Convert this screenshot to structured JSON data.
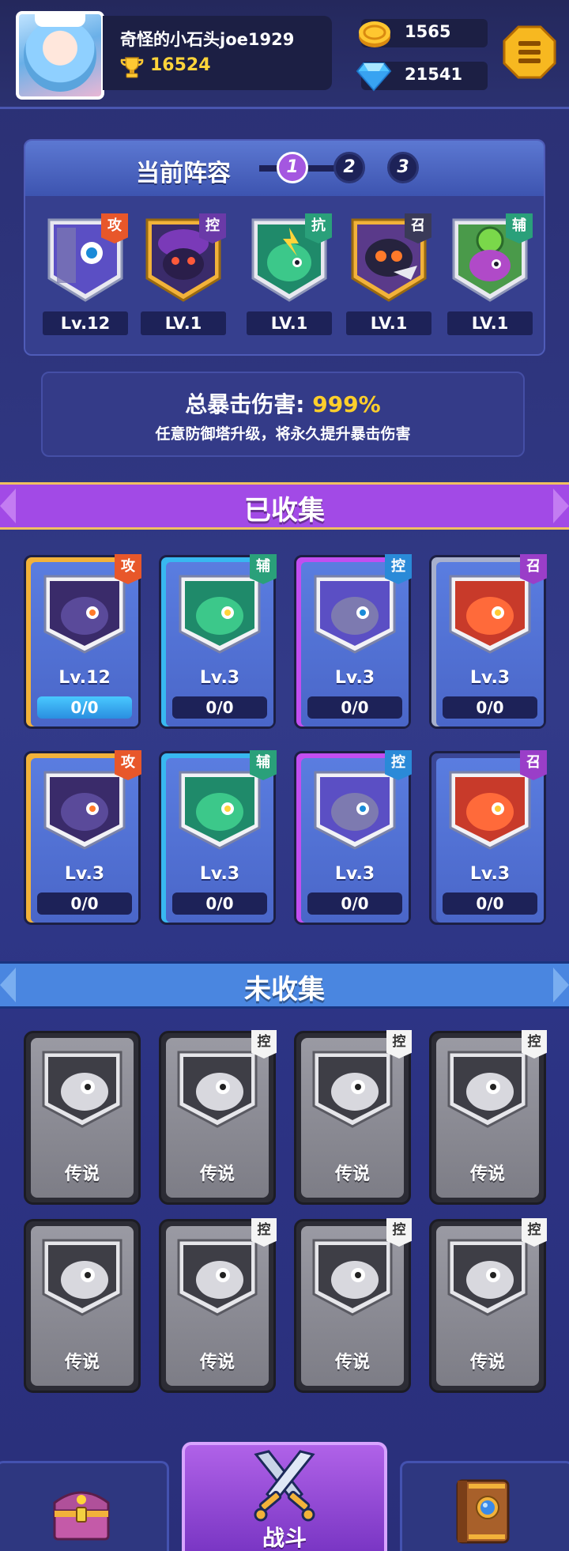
{
  "player": {
    "name": "奇怪的小石头joe1929",
    "trophies": "16524"
  },
  "resources": {
    "coins": "1565",
    "diamonds": "21541"
  },
  "lineup": {
    "title": "当前阵容",
    "slots": [
      "1",
      "2",
      "3"
    ],
    "active_slot": "1",
    "heroes": [
      {
        "tag": "攻",
        "level": "Lv.12",
        "color": "#5b4fc4"
      },
      {
        "tag": "控",
        "level": "LV.1",
        "color": "#6a3aa8"
      },
      {
        "tag": "抗",
        "level": "LV.1",
        "color": "#2aa86a"
      },
      {
        "tag": "召",
        "level": "LV.1",
        "color": "#3a3a58"
      },
      {
        "tag": "辅",
        "level": "LV.1",
        "color": "#3aa86a"
      }
    ]
  },
  "crit": {
    "title": "总暴击伤害:",
    "value": "999%",
    "subtitle": "任意防御塔升级，将永久提升暴击伤害"
  },
  "collected": {
    "title": "已收集",
    "cards": [
      {
        "tag": "攻",
        "level": "Lv.12",
        "progress": "0/0",
        "filled": true
      },
      {
        "tag": "辅",
        "level": "Lv.3",
        "progress": "0/0",
        "filled": false
      },
      {
        "tag": "控",
        "level": "Lv.3",
        "progress": "0/0",
        "filled": false
      },
      {
        "tag": "召",
        "level": "Lv.3",
        "progress": "0/0",
        "filled": false
      },
      {
        "tag": "攻",
        "level": "Lv.3",
        "progress": "0/0",
        "filled": false
      },
      {
        "tag": "辅",
        "level": "Lv.3",
        "progress": "0/0",
        "filled": false
      },
      {
        "tag": "控",
        "level": "Lv.3",
        "progress": "0/0",
        "filled": false
      },
      {
        "tag": "召",
        "level": "Lv.3",
        "progress": "0/0",
        "filled": false
      }
    ]
  },
  "uncollected": {
    "title": "未收集",
    "cards": [
      {
        "tag": "",
        "label": "传说"
      },
      {
        "tag": "控",
        "label": "传说"
      },
      {
        "tag": "控",
        "label": "传说"
      },
      {
        "tag": "控",
        "label": "传说"
      },
      {
        "tag": "",
        "label": "传说"
      },
      {
        "tag": "控",
        "label": "传说"
      },
      {
        "tag": "控",
        "label": "传说"
      },
      {
        "tag": "控",
        "label": "传说"
      }
    ]
  },
  "nav": {
    "battle_label": "战斗"
  },
  "colors": {
    "tag_attack": "#e8572a",
    "tag_support": "#2aa07a",
    "tag_control": "#2a8ad8",
    "tag_summon": "#9a3ec8",
    "frame_gold": "#f2b23a",
    "frame_cyan": "#38b8f0",
    "frame_purple": "#c24ef0",
    "frame_silver": "#a8b0cc"
  }
}
